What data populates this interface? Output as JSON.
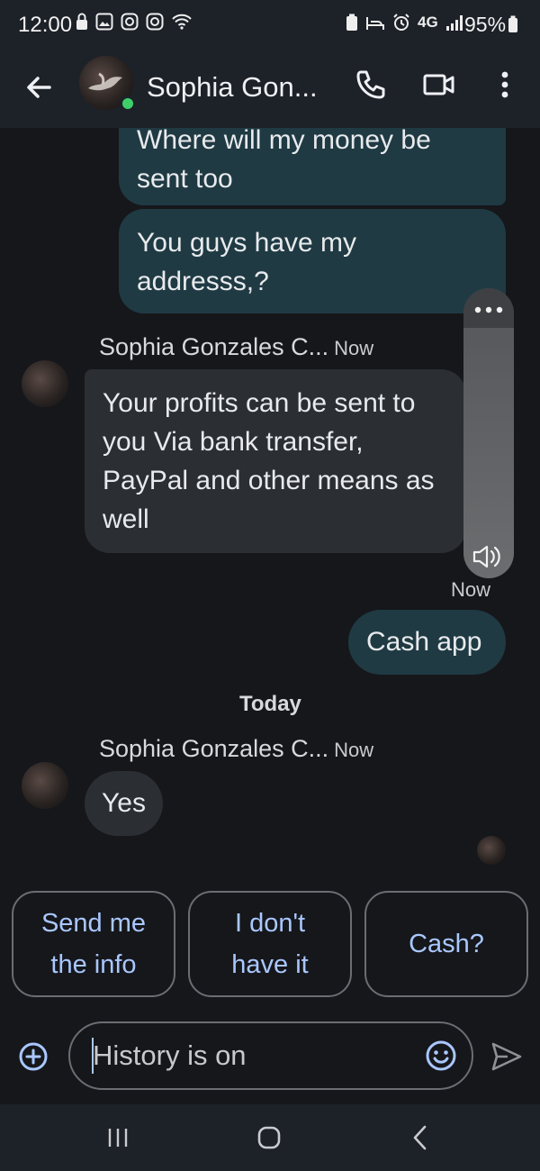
{
  "status_bar": {
    "time": "12:00",
    "network": "4G",
    "battery": "95%"
  },
  "header": {
    "contact_name": "Sophia Gon..."
  },
  "messages": {
    "out_1": "Where will my money be sent too",
    "out_2": "You guys have my addresss,?",
    "in_1_sender": "Sophia Gonzales C...",
    "in_1_time": "Now",
    "in_1_text": "Your profits can be sent to you Via bank transfer, PayPal and other means as well",
    "out_3_time": "Now",
    "out_3": "Cash app",
    "day_divider": "Today",
    "in_2_sender": "Sophia Gonzales C...",
    "in_2_time": "Now",
    "in_2_text": "Yes"
  },
  "smart_replies": [
    "Send me the info",
    "I don't have it",
    "Cash?"
  ],
  "composer": {
    "placeholder": "History is on"
  },
  "colors": {
    "background": "#16171b",
    "outgoing_bubble": "#1f3a43",
    "incoming_bubble": "#2b2e33",
    "accent": "#a9c7ff",
    "online": "#3fcf6a"
  }
}
